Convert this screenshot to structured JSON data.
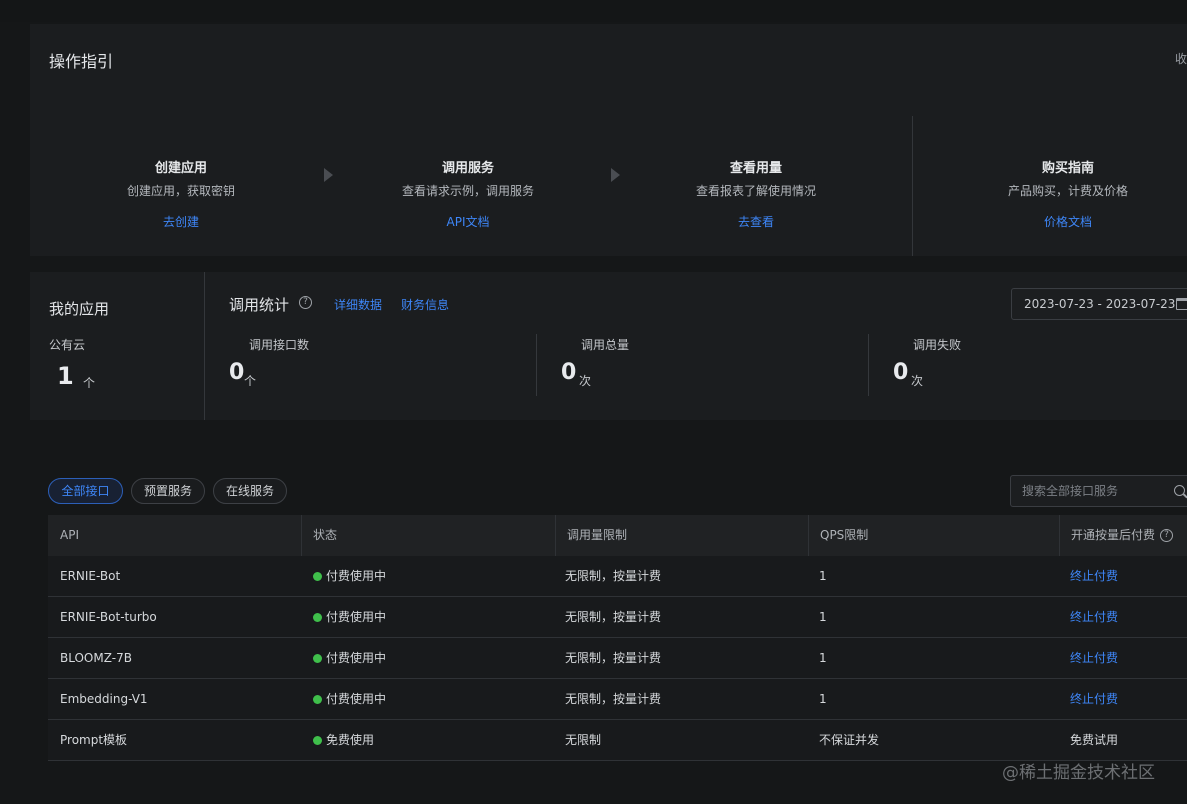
{
  "guide": {
    "title": "操作指引",
    "collapse": "收",
    "steps": [
      {
        "title": "创建应用",
        "desc": "创建应用，获取密钥",
        "link": "去创建"
      },
      {
        "title": "调用服务",
        "desc": "查看请求示例，调用服务",
        "link": "API文档"
      },
      {
        "title": "查看用量",
        "desc": "查看报表了解使用情况",
        "link": "去查看"
      },
      {
        "title": "购买指南",
        "desc": "产品购买，计费及价格",
        "link": "价格文档"
      }
    ]
  },
  "my_apps": {
    "title": "我的应用",
    "sub": "公有云",
    "count": "1",
    "unit": "个"
  },
  "stats": {
    "title": "调用统计",
    "help": "?",
    "link_detail": "详细数据",
    "link_finance": "财务信息",
    "date_range": "2023-07-23 - 2023-07-23",
    "metrics": [
      {
        "label": "调用接口数",
        "value": "0",
        "unit": "个"
      },
      {
        "label": "调用总量",
        "value": "0",
        "unit": "次"
      },
      {
        "label": "调用失败",
        "value": "0",
        "unit": "次"
      }
    ]
  },
  "filters": {
    "pills": [
      "全部接口",
      "预置服务",
      "在线服务"
    ],
    "search_placeholder": "搜索全部接口服务"
  },
  "table": {
    "headers": [
      "API",
      "状态",
      "调用量限制",
      "QPS限制",
      "开通按量后付费"
    ],
    "help": "?",
    "rows": [
      {
        "api": "ERNIE-Bot",
        "status": "付费使用中",
        "limit": "无限制，按量计费",
        "qps": "1",
        "action": "终止付费"
      },
      {
        "api": "ERNIE-Bot-turbo",
        "status": "付费使用中",
        "limit": "无限制，按量计费",
        "qps": "1",
        "action": "终止付费"
      },
      {
        "api": "BLOOMZ-7B",
        "status": "付费使用中",
        "limit": "无限制，按量计费",
        "qps": "1",
        "action": "终止付费"
      },
      {
        "api": "Embedding-V1",
        "status": "付费使用中",
        "limit": "无限制，按量计费",
        "qps": "1",
        "action": "终止付费"
      },
      {
        "api": "Prompt模板",
        "status": "免费使用",
        "limit": "无限制",
        "qps": "不保证并发",
        "action": "免费试用"
      }
    ]
  },
  "watermark": "@稀土掘金技术社区",
  "colors": {
    "accent": "#3e86f7",
    "status_green": "#3fbf4b",
    "background": "#151718"
  }
}
